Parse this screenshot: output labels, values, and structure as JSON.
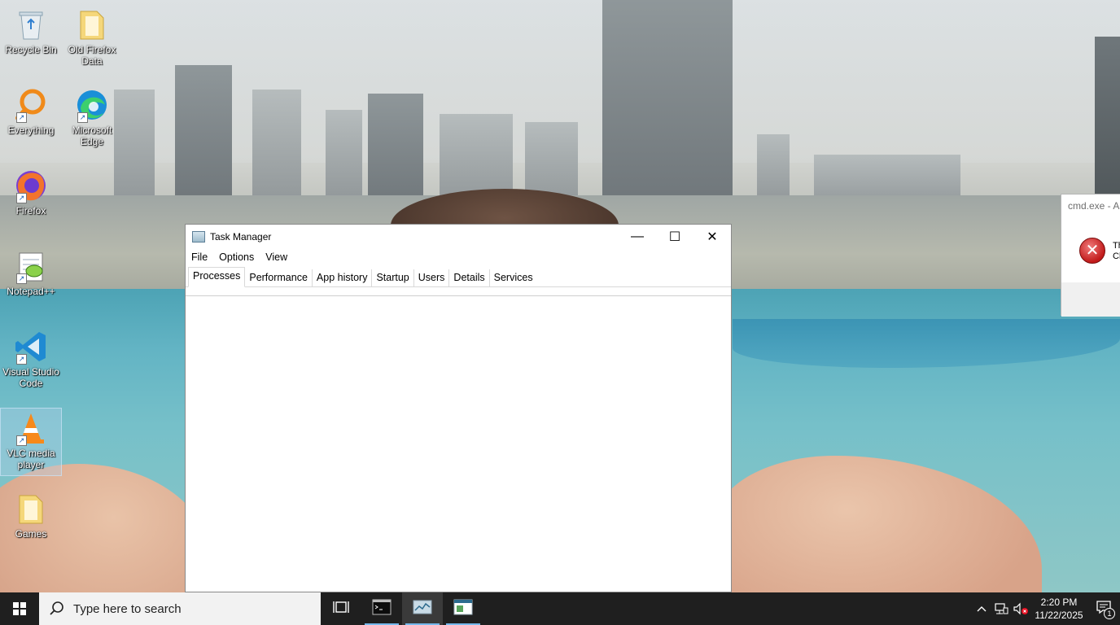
{
  "desktop": {
    "icons": [
      {
        "label": "Recycle Bin"
      },
      {
        "label": "Old Firefox Data"
      },
      {
        "label": "Everything"
      },
      {
        "label": "Microsoft Edge"
      },
      {
        "label": "Firefox"
      },
      {
        "label": "Notepad++"
      },
      {
        "label": "Visual Studio Code"
      },
      {
        "label": "VLC media player"
      },
      {
        "label": "Games"
      }
    ]
  },
  "task_manager": {
    "title": "Task Manager",
    "menu": [
      "File",
      "Options",
      "View"
    ],
    "tabs": [
      "Processes",
      "Performance",
      "App history",
      "Startup",
      "Users",
      "Details",
      "Services"
    ],
    "active_tab": "Processes",
    "controls": {
      "minimize": "—",
      "maximize": "☐",
      "close": "✕"
    }
  },
  "cmd_dialog": {
    "title": "cmd.exe - A",
    "message_line1": "Th",
    "message_line2": "Cl",
    "error_glyph": "✕"
  },
  "taskbar": {
    "search_placeholder": "Type here to search",
    "clock_time": "2:20 PM",
    "clock_date": "11/22/2025",
    "notification_count": "1",
    "accent_color": "#76b9ed"
  }
}
